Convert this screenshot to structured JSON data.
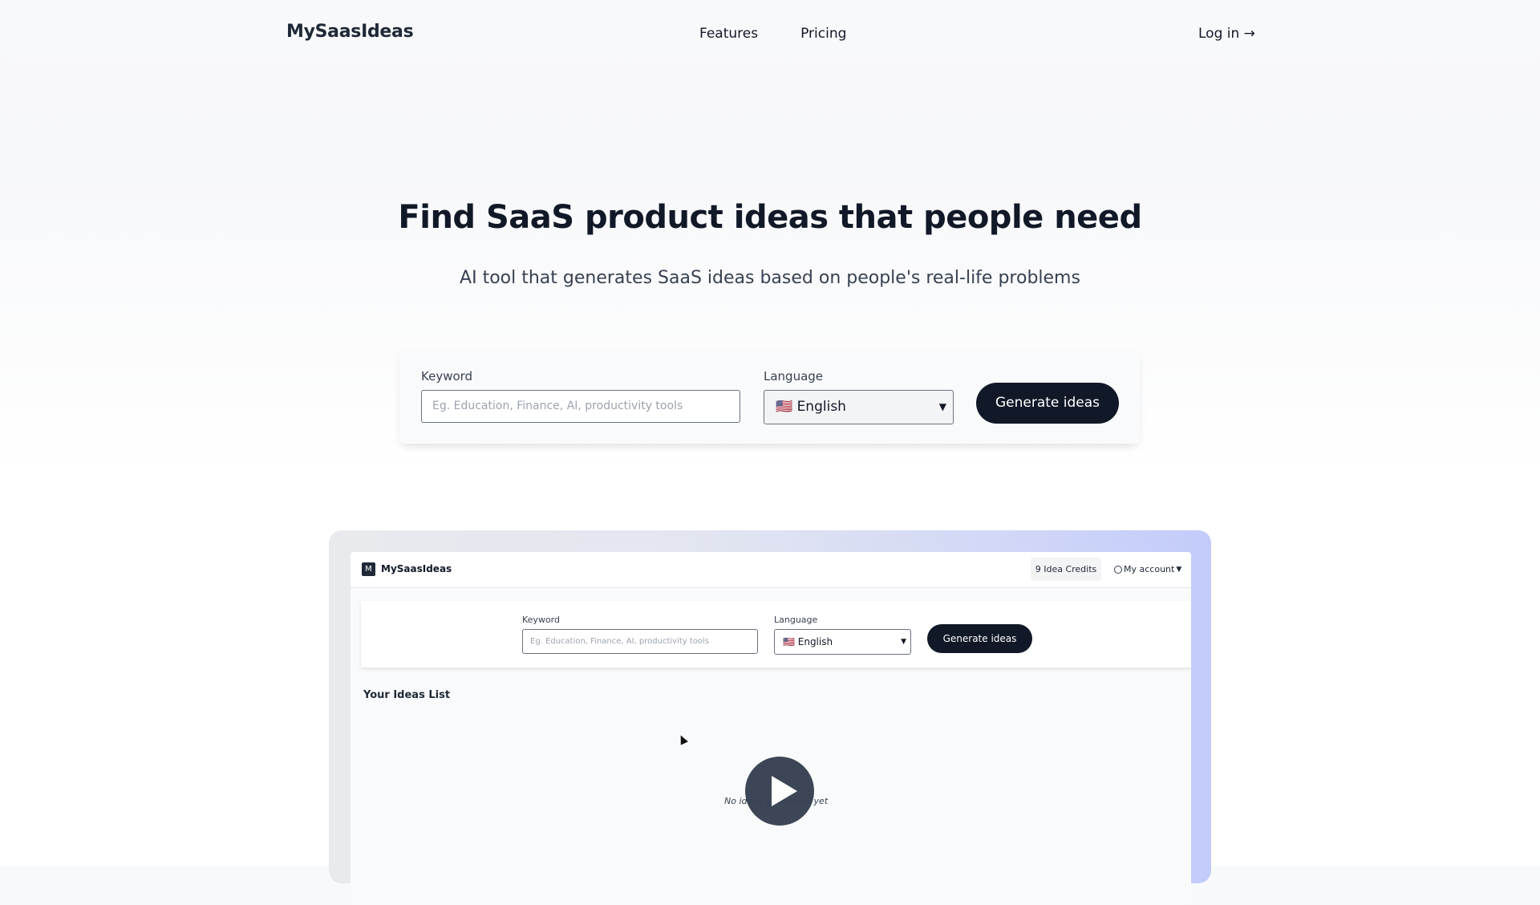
{
  "nav": {
    "brand": "MySaasIdeas",
    "links": [
      "Features",
      "Pricing"
    ],
    "login": "Log in →"
  },
  "hero": {
    "title": "Find SaaS product ideas that people need",
    "subtitle": "AI tool that generates SaaS ideas based on people's real-life problems"
  },
  "form": {
    "keyword_label": "Keyword",
    "keyword_placeholder": "Eg. Education, Finance, AI, productivity tools",
    "language_label": "Language",
    "language_value": "🇺🇸 English",
    "generate_label": "Generate ideas"
  },
  "preview": {
    "brand": "MySaasIdeas",
    "credits": "9 Idea Credits",
    "account": "My account",
    "keyword_label": "Keyword",
    "keyword_placeholder": "Eg. Education, Finance, AI, productivity tools",
    "language_label": "Language",
    "language_value": "🇺🇸 English",
    "generate_label": "Generate ideas",
    "ideas_title": "Your Ideas List",
    "empty_text": "No ideas generated yet"
  },
  "colors": {
    "primary": "#111827",
    "frame_accent": "#c3cbfb"
  },
  "icons": {
    "play": "play-icon",
    "account": "user-circle-icon",
    "chevron": "chevron-down-icon"
  }
}
